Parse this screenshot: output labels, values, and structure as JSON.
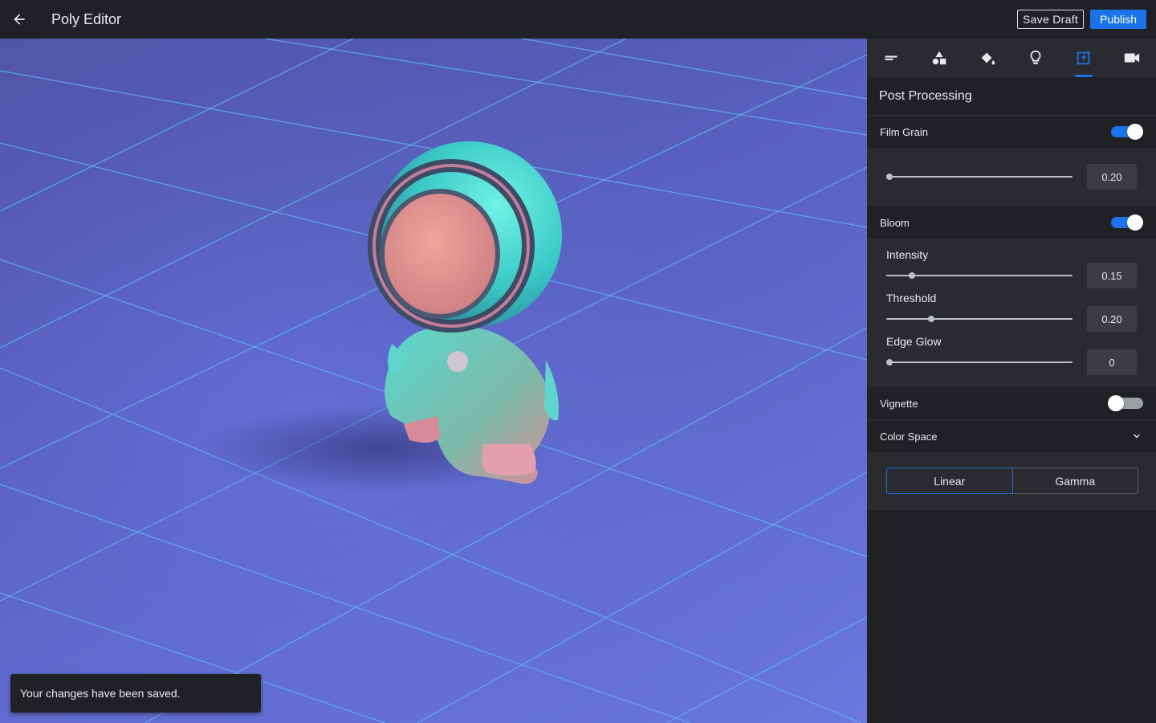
{
  "app": {
    "title": "Poly Editor",
    "back_icon": "arrow-back-icon"
  },
  "toolbar": {
    "save_draft_label": "Save Draft",
    "publish_label": "Publish"
  },
  "toast": {
    "message": "Your changes have been saved."
  },
  "panel": {
    "tabs": [
      {
        "icon": "subject-icon",
        "active": false
      },
      {
        "icon": "shapes-icon",
        "active": false
      },
      {
        "icon": "paint-bucket-icon",
        "active": false
      },
      {
        "icon": "lightbulb-icon",
        "active": false
      },
      {
        "icon": "post-processing-icon",
        "active": true
      },
      {
        "icon": "camera-icon",
        "active": false
      }
    ],
    "title": "Post Processing",
    "film_grain": {
      "label": "Film Grain",
      "enabled": true,
      "value": "0.20"
    },
    "bloom": {
      "label": "Bloom",
      "enabled": true,
      "intensity": {
        "label": "Intensity",
        "value": "0.15"
      },
      "threshold": {
        "label": "Threshold",
        "value": "0.20"
      },
      "edge_glow": {
        "label": "Edge Glow",
        "value": "0"
      }
    },
    "vignette": {
      "label": "Vignette",
      "enabled": false
    },
    "color_space": {
      "label": "Color Space",
      "options": [
        "Linear",
        "Gamma"
      ],
      "selected": "Linear"
    }
  },
  "colors": {
    "accent": "#1a73e8",
    "panel_bg": "#202124",
    "section_bg": "#2a2b2e"
  }
}
